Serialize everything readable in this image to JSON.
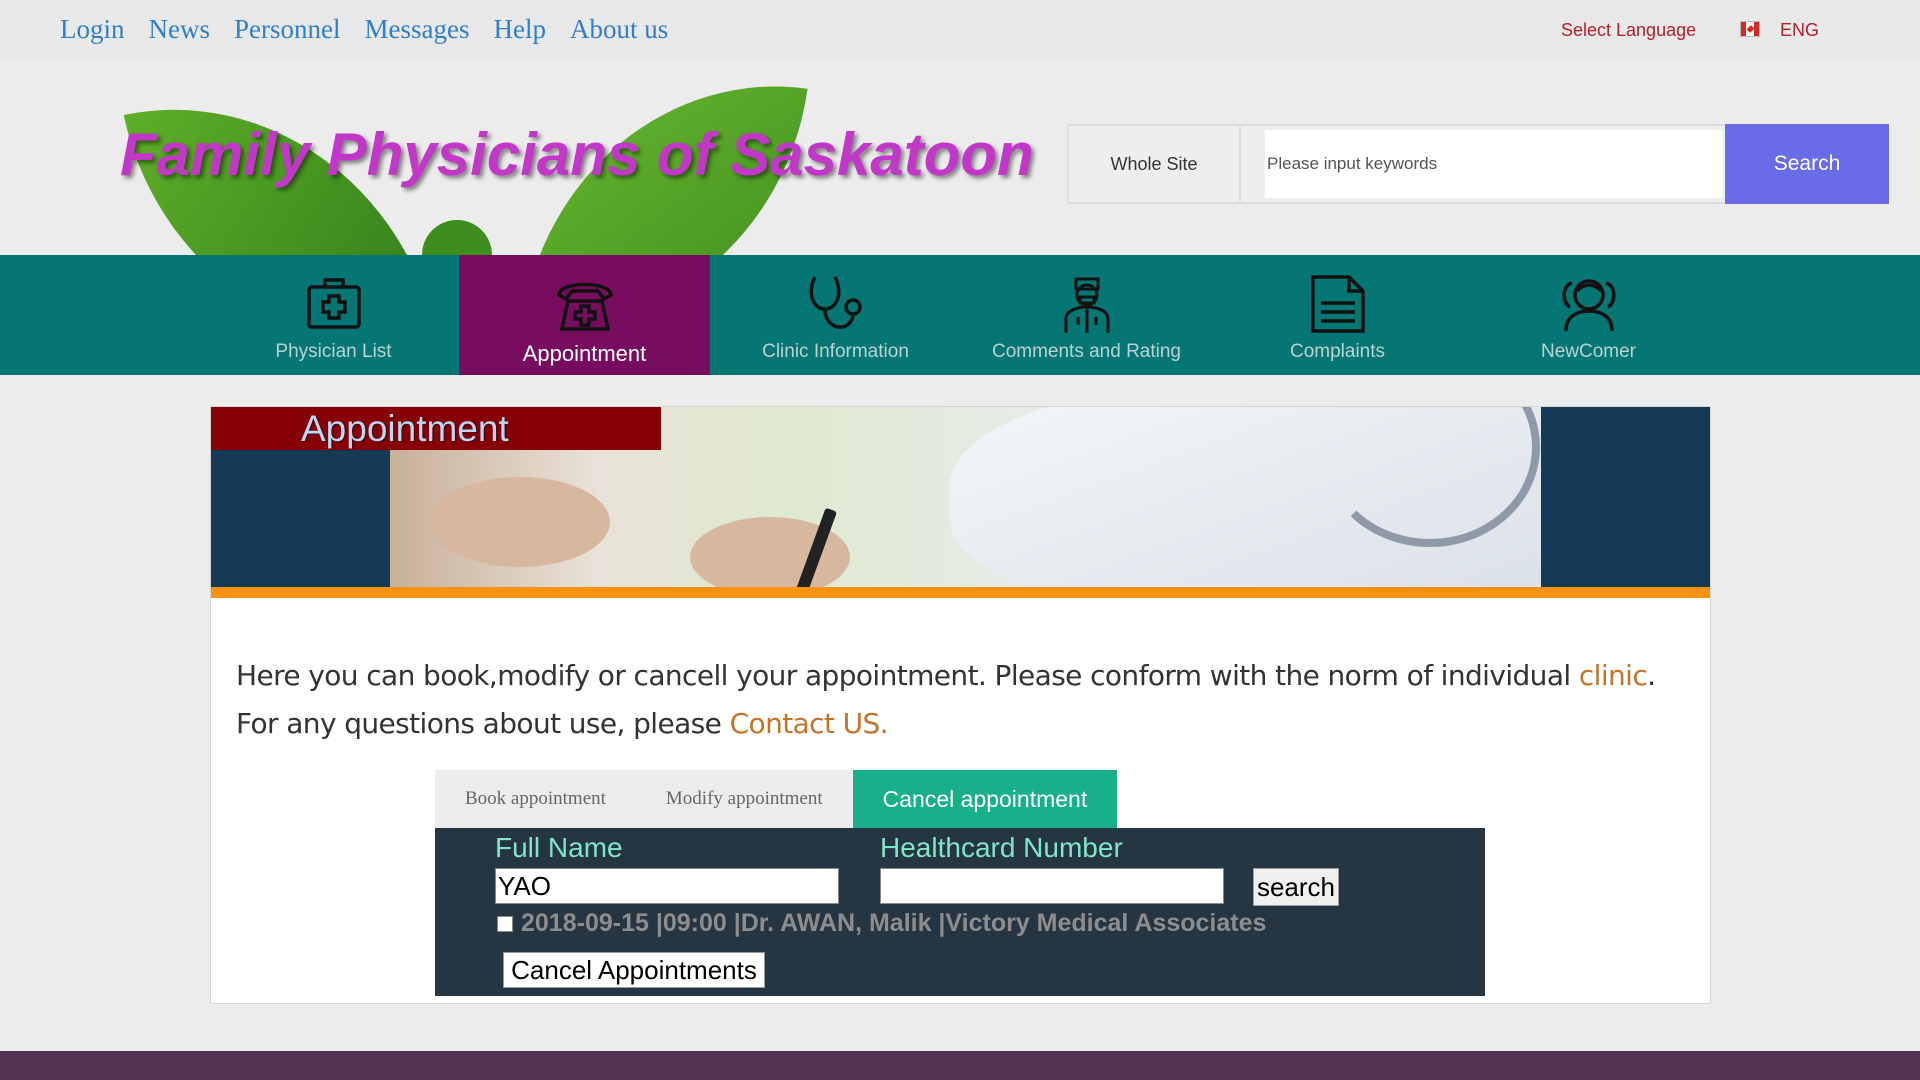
{
  "topnav": [
    "Login",
    "News",
    "Personnel",
    "Messages",
    "Help",
    "About us"
  ],
  "language": {
    "select_label": "Select Language",
    "current": "ENG",
    "flag_icon": "canada-flag-icon"
  },
  "site_title": "Family Physicians of Saskatoon",
  "search": {
    "scope": "Whole Site",
    "placeholder": "Please input keywords",
    "button": "Search"
  },
  "mainnav": [
    {
      "label": "Physician List",
      "icon": "first-aid-kit-icon",
      "active": false
    },
    {
      "label": "Appointment",
      "icon": "telephone-icon",
      "active": true
    },
    {
      "label": "Clinic Information",
      "icon": "stethoscope-icon",
      "active": false
    },
    {
      "label": "Comments and Rating",
      "icon": "doctor-icon",
      "active": false
    },
    {
      "label": "Complaints",
      "icon": "document-icon",
      "active": false
    },
    {
      "label": "NewComer",
      "icon": "people-icon",
      "active": false
    }
  ],
  "banner_title": "Appointment",
  "intro": {
    "line1_text": "Here you can book,modify or cancell your appointment. Please conform with the norm of individual ",
    "line1_link": "clinic",
    "line1_end": ".",
    "line2_text": "For any questions about use, please ",
    "line2_link": "Contact US."
  },
  "tabs": [
    {
      "label": "Book appointment",
      "active": false
    },
    {
      "label": "Modify appointment",
      "active": false
    },
    {
      "label": "Cancel appointment",
      "active": true
    }
  ],
  "cancel_form": {
    "full_name_label": "Full Name",
    "full_name_value": "YAO",
    "healthcard_label": "Healthcard Number",
    "healthcard_value": "",
    "search_button": "search",
    "appointment": "2018-09-15 |09:00 |Dr. AWAN, Malik |Victory Medical Associates",
    "cancel_button": "Cancel Appointments"
  },
  "colors": {
    "nav_bg": "#057673",
    "nav_active": "#780c5e",
    "search_btn": "#6a6be6",
    "tab_active": "#17b08a",
    "title": "#c236c8"
  }
}
